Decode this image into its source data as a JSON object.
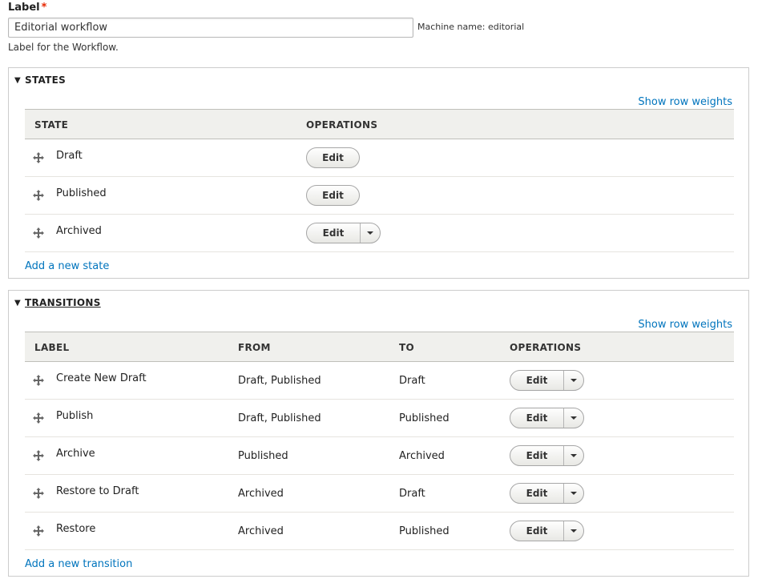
{
  "label_field": {
    "title": "Label",
    "required_mark": "*",
    "value": "Editorial workflow",
    "machine_name": "Machine name: editorial",
    "description": "Label for the Workflow."
  },
  "states": {
    "legend": "STATES",
    "show_weights": "Show row weights",
    "headers": [
      "STATE",
      "OPERATIONS"
    ],
    "rows": [
      {
        "name": "Draft",
        "op": "Edit",
        "dropdown": false
      },
      {
        "name": "Published",
        "op": "Edit",
        "dropdown": false
      },
      {
        "name": "Archived",
        "op": "Edit",
        "dropdown": true
      }
    ],
    "add_link": "Add a new state"
  },
  "transitions": {
    "legend": "TRANSITIONS",
    "show_weights": "Show row weights",
    "headers": [
      "LABEL",
      "FROM",
      "TO",
      "OPERATIONS"
    ],
    "rows": [
      {
        "label": "Create New Draft",
        "from": "Draft, Published",
        "to": "Draft",
        "op": "Edit"
      },
      {
        "label": "Publish",
        "from": "Draft, Published",
        "to": "Published",
        "op": "Edit"
      },
      {
        "label": "Archive",
        "from": "Published",
        "to": "Archived",
        "op": "Edit"
      },
      {
        "label": "Restore to Draft",
        "from": "Archived",
        "to": "Draft",
        "op": "Edit"
      },
      {
        "label": "Restore",
        "from": "Archived",
        "to": "Published",
        "op": "Edit"
      }
    ],
    "add_link": "Add a new transition"
  },
  "colors": {
    "link": "#0074bd",
    "required": "#e62600"
  },
  "icons": {
    "drag": "move-arrows-icon",
    "collapse": "triangle-down-icon",
    "dropdown": "caret-down-icon"
  }
}
